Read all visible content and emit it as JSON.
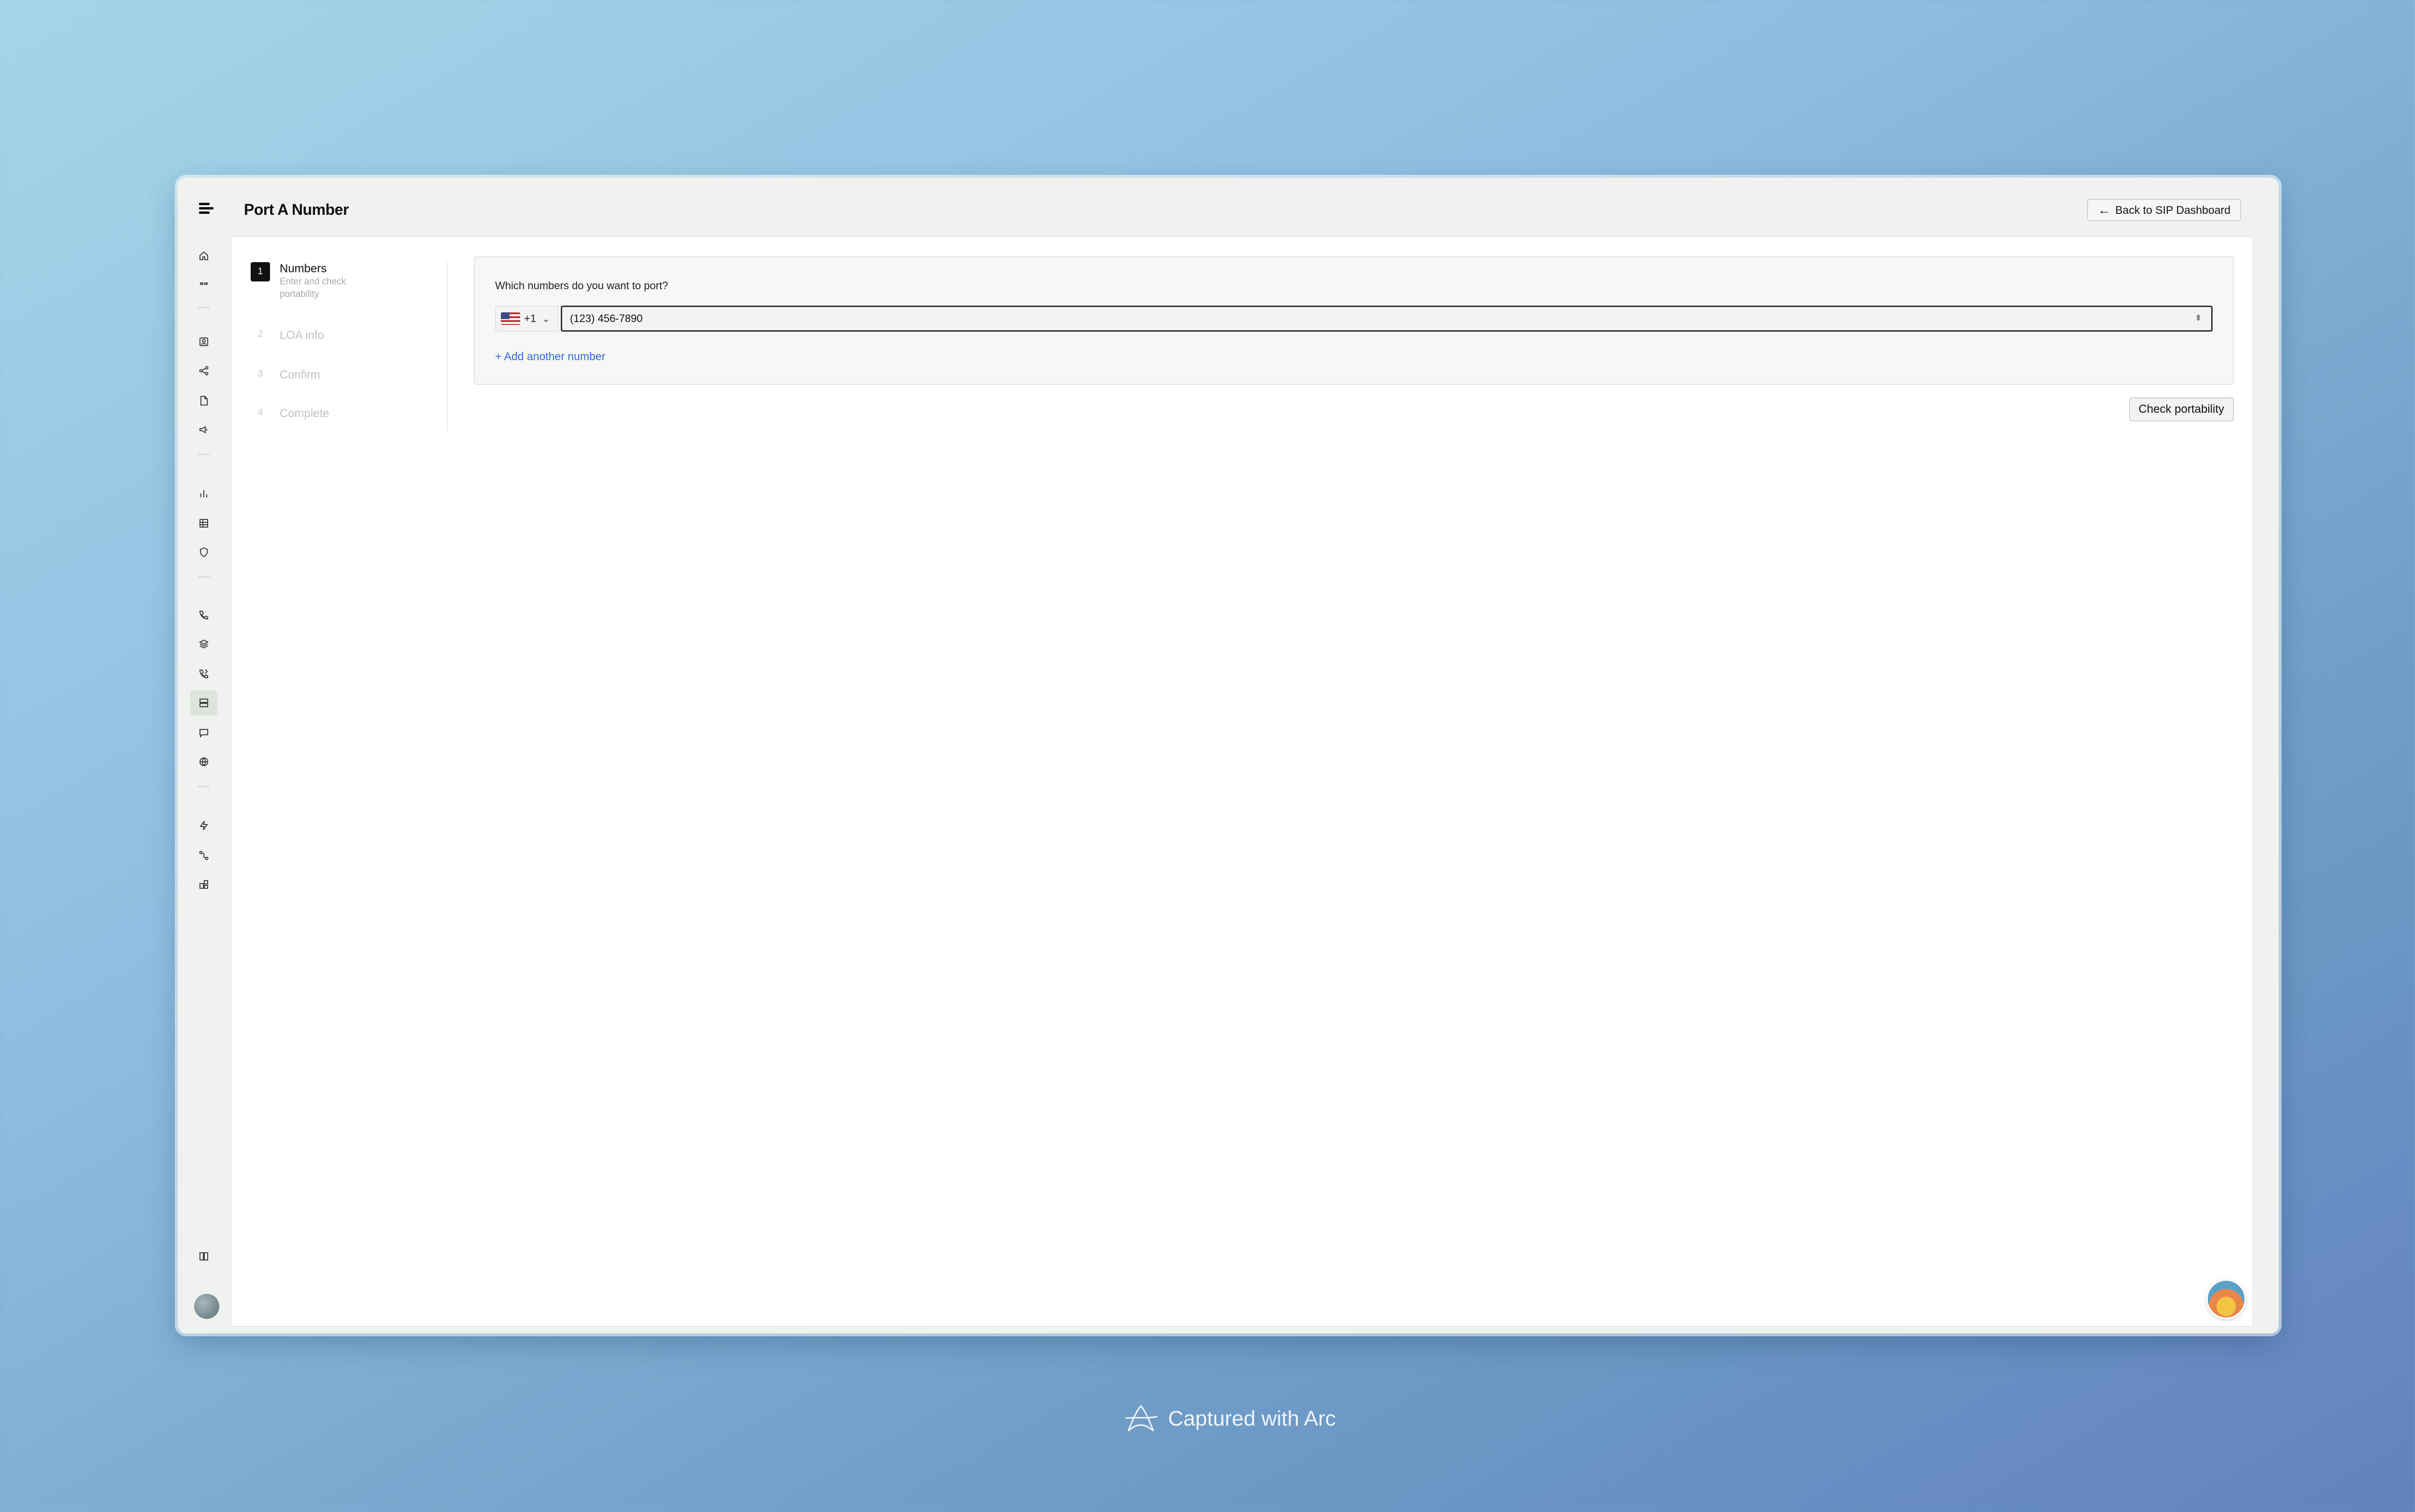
{
  "header": {
    "title": "Port A Number",
    "back_label": "Back to SIP Dashboard"
  },
  "sidebar": {
    "icons": [
      "home-icon",
      "quote-icon",
      "contacts-icon",
      "share-icon",
      "file-icon",
      "megaphone-icon",
      "chart-icon",
      "table-icon",
      "shield-icon",
      "phone-icon",
      "stack-icon",
      "phone-forward-icon",
      "server-icon",
      "message-icon",
      "globe-icon",
      "bolt-icon",
      "route-icon",
      "integrations-icon",
      "book-icon"
    ]
  },
  "steps": [
    {
      "num": "1",
      "title": "Numbers",
      "subtitle": "Enter and check portability"
    },
    {
      "num": "2",
      "title": "LOA info"
    },
    {
      "num": "3",
      "title": "Confirm"
    },
    {
      "num": "4",
      "title": "Complete"
    }
  ],
  "form": {
    "question": "Which numbers do you want to port?",
    "country_code": "+1",
    "phone_value": "(123) 456-7890",
    "add_label": "+ Add another number",
    "check_label": "Check portability"
  },
  "footer": {
    "text": "Captured with Arc"
  }
}
